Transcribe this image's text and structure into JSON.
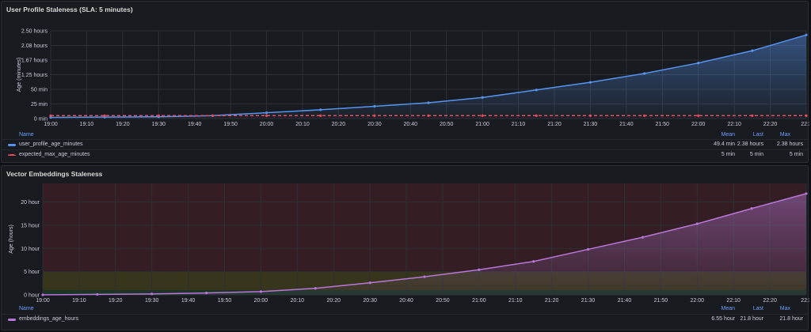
{
  "panels": [
    {
      "title": "User Profile Staleness (SLA: 5 minutes)",
      "legend_header": {
        "name": "Name",
        "mean": "Mean",
        "last": "Last",
        "max": "Max"
      },
      "legend_rows": [
        {
          "name": "user_profile_age_minutes",
          "color": "#5794f2",
          "style": "solid",
          "mean": "49.4 min",
          "last": "2.38 hours",
          "max": "2.38 hours"
        },
        {
          "name": "expected_max_age_minutes",
          "color": "#f2495c",
          "style": "dashed",
          "mean": "5 min",
          "last": "5 min",
          "max": "5 min"
        }
      ]
    },
    {
      "title": "Vector Embeddings Staleness",
      "legend_header": {
        "name": "Name",
        "mean": "Mean",
        "last": "Last",
        "max": "Max"
      },
      "legend_rows": [
        {
          "name": "embeddings_age_hours",
          "color": "#b877d9",
          "style": "solid",
          "mean": "6.55 hour",
          "last": "21.8 hour",
          "max": "21.8 hour"
        }
      ]
    }
  ],
  "chart_data": [
    {
      "type": "line",
      "title": "User Profile Staleness (SLA: 5 minutes)",
      "ylabel": "Age (minutes)",
      "ylim": [
        0,
        150
      ],
      "xlim": [
        "19:00",
        "22:30"
      ],
      "yticks": [
        0,
        25,
        50,
        75,
        100,
        125,
        150
      ],
      "ytick_labels": [
        "0 min",
        "25 min",
        "50 min",
        "1.25 hours",
        "1.67 hours",
        "2.08 hours",
        "2.50 hours"
      ],
      "xtick_labels": [
        "19:00",
        "19:10",
        "19:20",
        "19:30",
        "19:40",
        "19:50",
        "20:00",
        "20:10",
        "20:20",
        "20:30",
        "20:40",
        "20:50",
        "21:00",
        "21:10",
        "21:20",
        "21:30",
        "21:40",
        "21:50",
        "22:00",
        "22:10",
        "22:20",
        "22:3"
      ],
      "grid": true,
      "legend_position": "bottom",
      "series": [
        {
          "name": "user_profile_age_minutes",
          "color": "#5794f2",
          "fill": true,
          "x": [
            "19:00",
            "19:15",
            "19:30",
            "19:45",
            "20:00",
            "20:15",
            "20:30",
            "20:45",
            "21:00",
            "21:15",
            "21:30",
            "21:45",
            "22:00",
            "22:15",
            "22:30"
          ],
          "values": [
            2,
            2.5,
            3,
            5,
            10,
            15,
            21,
            27,
            36,
            49,
            62,
            77,
            95,
            116,
            143
          ]
        },
        {
          "name": "expected_max_age_minutes",
          "color": "#f2495c",
          "dashed": true,
          "x": [
            "19:00",
            "19:15",
            "19:30",
            "19:45",
            "20:00",
            "20:15",
            "20:30",
            "20:45",
            "21:00",
            "21:15",
            "21:30",
            "21:45",
            "22:00",
            "22:15",
            "22:30"
          ],
          "values": [
            5,
            5,
            5,
            5,
            5,
            5,
            5,
            5,
            5,
            5,
            5,
            5,
            5,
            5,
            5
          ]
        }
      ]
    },
    {
      "type": "line",
      "title": "Vector Embeddings Staleness",
      "ylabel": "Age (hours)",
      "ylim": [
        0,
        24
      ],
      "xlim": [
        "19:00",
        "22:30"
      ],
      "yticks": [
        0,
        5,
        10,
        15,
        20
      ],
      "ytick_labels": [
        "0 hour",
        "5 hour",
        "10 hour",
        "15 hour",
        "20 hour"
      ],
      "xtick_labels": [
        "19:00",
        "19:10",
        "19:20",
        "19:30",
        "19:40",
        "19:50",
        "20:00",
        "20:10",
        "20:20",
        "20:30",
        "20:40",
        "20:50",
        "21:00",
        "21:10",
        "21:20",
        "21:30",
        "21:40",
        "21:50",
        "22:00",
        "22:10",
        "22:20",
        "22:3"
      ],
      "grid": true,
      "legend_position": "bottom",
      "threshold_bands": [
        {
          "from": 0,
          "to": 1,
          "color": "#1f3a2a"
        },
        {
          "from": 1,
          "to": 5,
          "color": "#3d3a1c"
        },
        {
          "from": 5,
          "to": 24,
          "color": "#3a1f24"
        }
      ],
      "series": [
        {
          "name": "embeddings_age_hours",
          "color": "#b877d9",
          "fill": true,
          "x": [
            "19:00",
            "19:15",
            "19:30",
            "19:45",
            "20:00",
            "20:15",
            "20:30",
            "20:45",
            "21:00",
            "21:15",
            "21:30",
            "21:45",
            "22:00",
            "22:15",
            "22:30"
          ],
          "values": [
            0,
            0.1,
            0.2,
            0.4,
            0.7,
            1.4,
            2.6,
            3.9,
            5.4,
            7.2,
            9.8,
            12.4,
            15.3,
            18.6,
            21.8
          ]
        }
      ]
    }
  ]
}
